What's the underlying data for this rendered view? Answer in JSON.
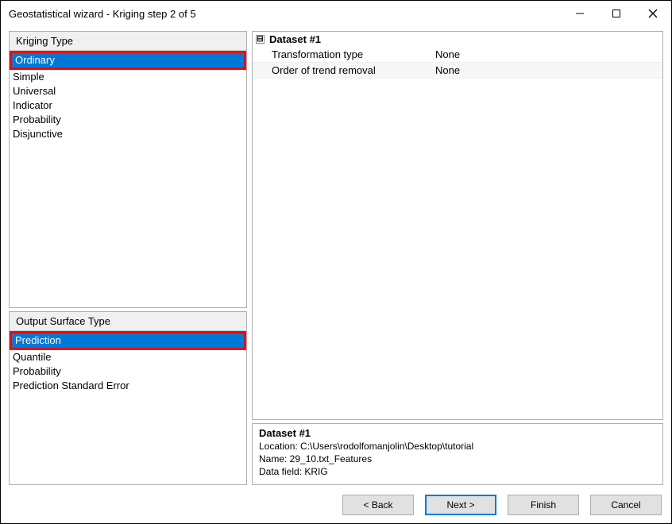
{
  "window": {
    "title": "Geostatistical wizard - Kriging step 2 of 5"
  },
  "krigingType": {
    "header": "Kriging Type",
    "items": [
      "Ordinary",
      "Simple",
      "Universal",
      "Indicator",
      "Probability",
      "Disjunctive"
    ],
    "selectedIndex": 0
  },
  "outputSurfaceType": {
    "header": "Output Surface Type",
    "items": [
      "Prediction",
      "Quantile",
      "Probability",
      "Prediction Standard Error"
    ],
    "selectedIndex": 0
  },
  "dataset": {
    "collapseGlyph": "⊟",
    "title": "Dataset #1",
    "rows": [
      {
        "label": "Transformation type",
        "value": "None"
      },
      {
        "label": "Order of trend removal",
        "value": "None"
      }
    ]
  },
  "info": {
    "title": "Dataset #1",
    "lines": [
      "Location: C:\\Users\\rodolfomanjolin\\Desktop\\tutorial",
      "Name: 29_10.txt_Features",
      "Data field: KRIG"
    ]
  },
  "buttons": {
    "back": "< Back",
    "next": "Next >",
    "finish": "Finish",
    "cancel": "Cancel"
  }
}
